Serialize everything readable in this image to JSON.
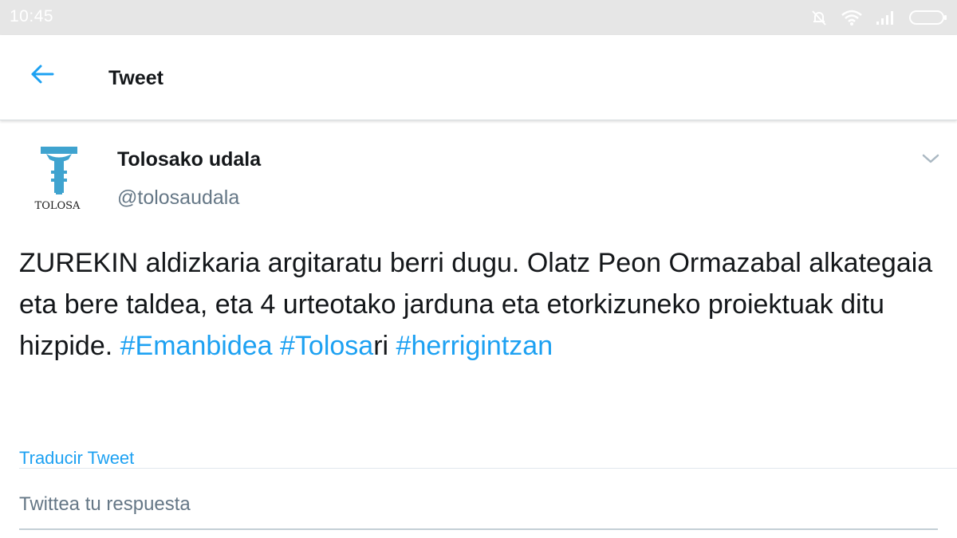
{
  "status_bar": {
    "time": "10:45",
    "icons": [
      "mute-bell-icon",
      "wifi-icon",
      "signal-icon",
      "battery-icon"
    ]
  },
  "header": {
    "title": "Tweet",
    "back_icon": "arrow-left-icon"
  },
  "tweet": {
    "author_name": "Tolosako udala",
    "handle": "@tolosaudala",
    "avatar_text": "TOLOSA",
    "text_plain": "ZUREKIN aldizkaria argitaratu berri dugu. Olatz Peon Ormazabal alkategaia eta bere taldea, eta 4 urteotako jarduna eta etorkizuneko proiektuak ditu hizpide. ",
    "hashtags": [
      "#Emanbidea",
      "#Tolosa"
    ],
    "text_tail": "ri ",
    "hashtag_last": "#herrigintzan",
    "translate_label": "Traducir Tweet"
  },
  "reply": {
    "placeholder": "Twittea tu respuesta",
    "value": ""
  },
  "colors": {
    "accent": "#1da1f2",
    "text": "#14171a",
    "secondary_text": "#657786",
    "status_bar": "#e6e6e6"
  }
}
